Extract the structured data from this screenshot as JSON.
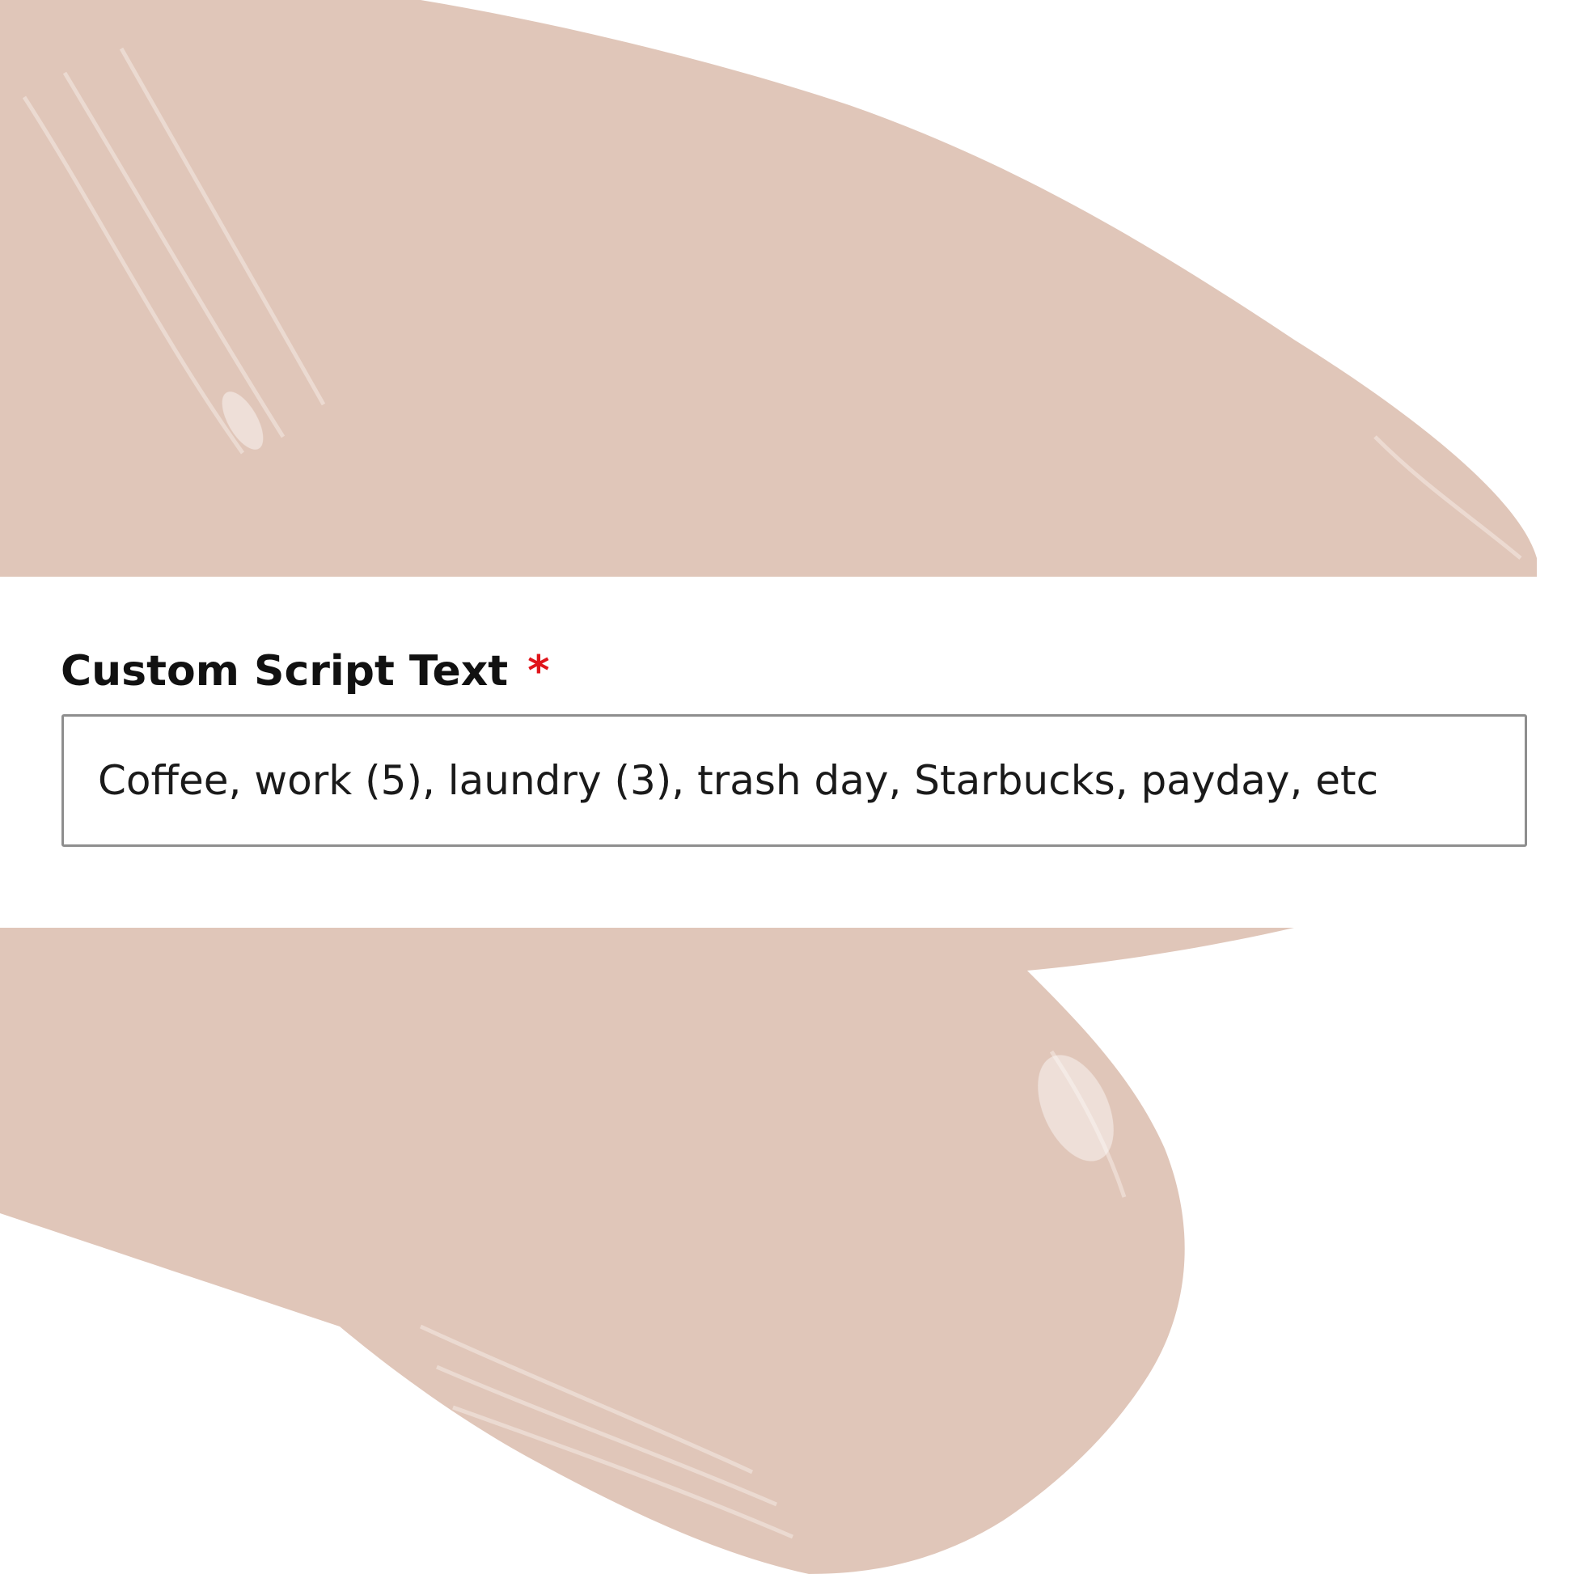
{
  "form": {
    "field_label": "Custom Script Text",
    "required_marker": "*",
    "input_value": "Coffee, work (5), laundry (3), trash day, Starbucks, payday, etc"
  },
  "colors": {
    "paint_swatch": "#e0c6b9",
    "required_marker": "#e0151b",
    "input_border": "#8e8e8e",
    "panel_background": "#ffffff"
  }
}
